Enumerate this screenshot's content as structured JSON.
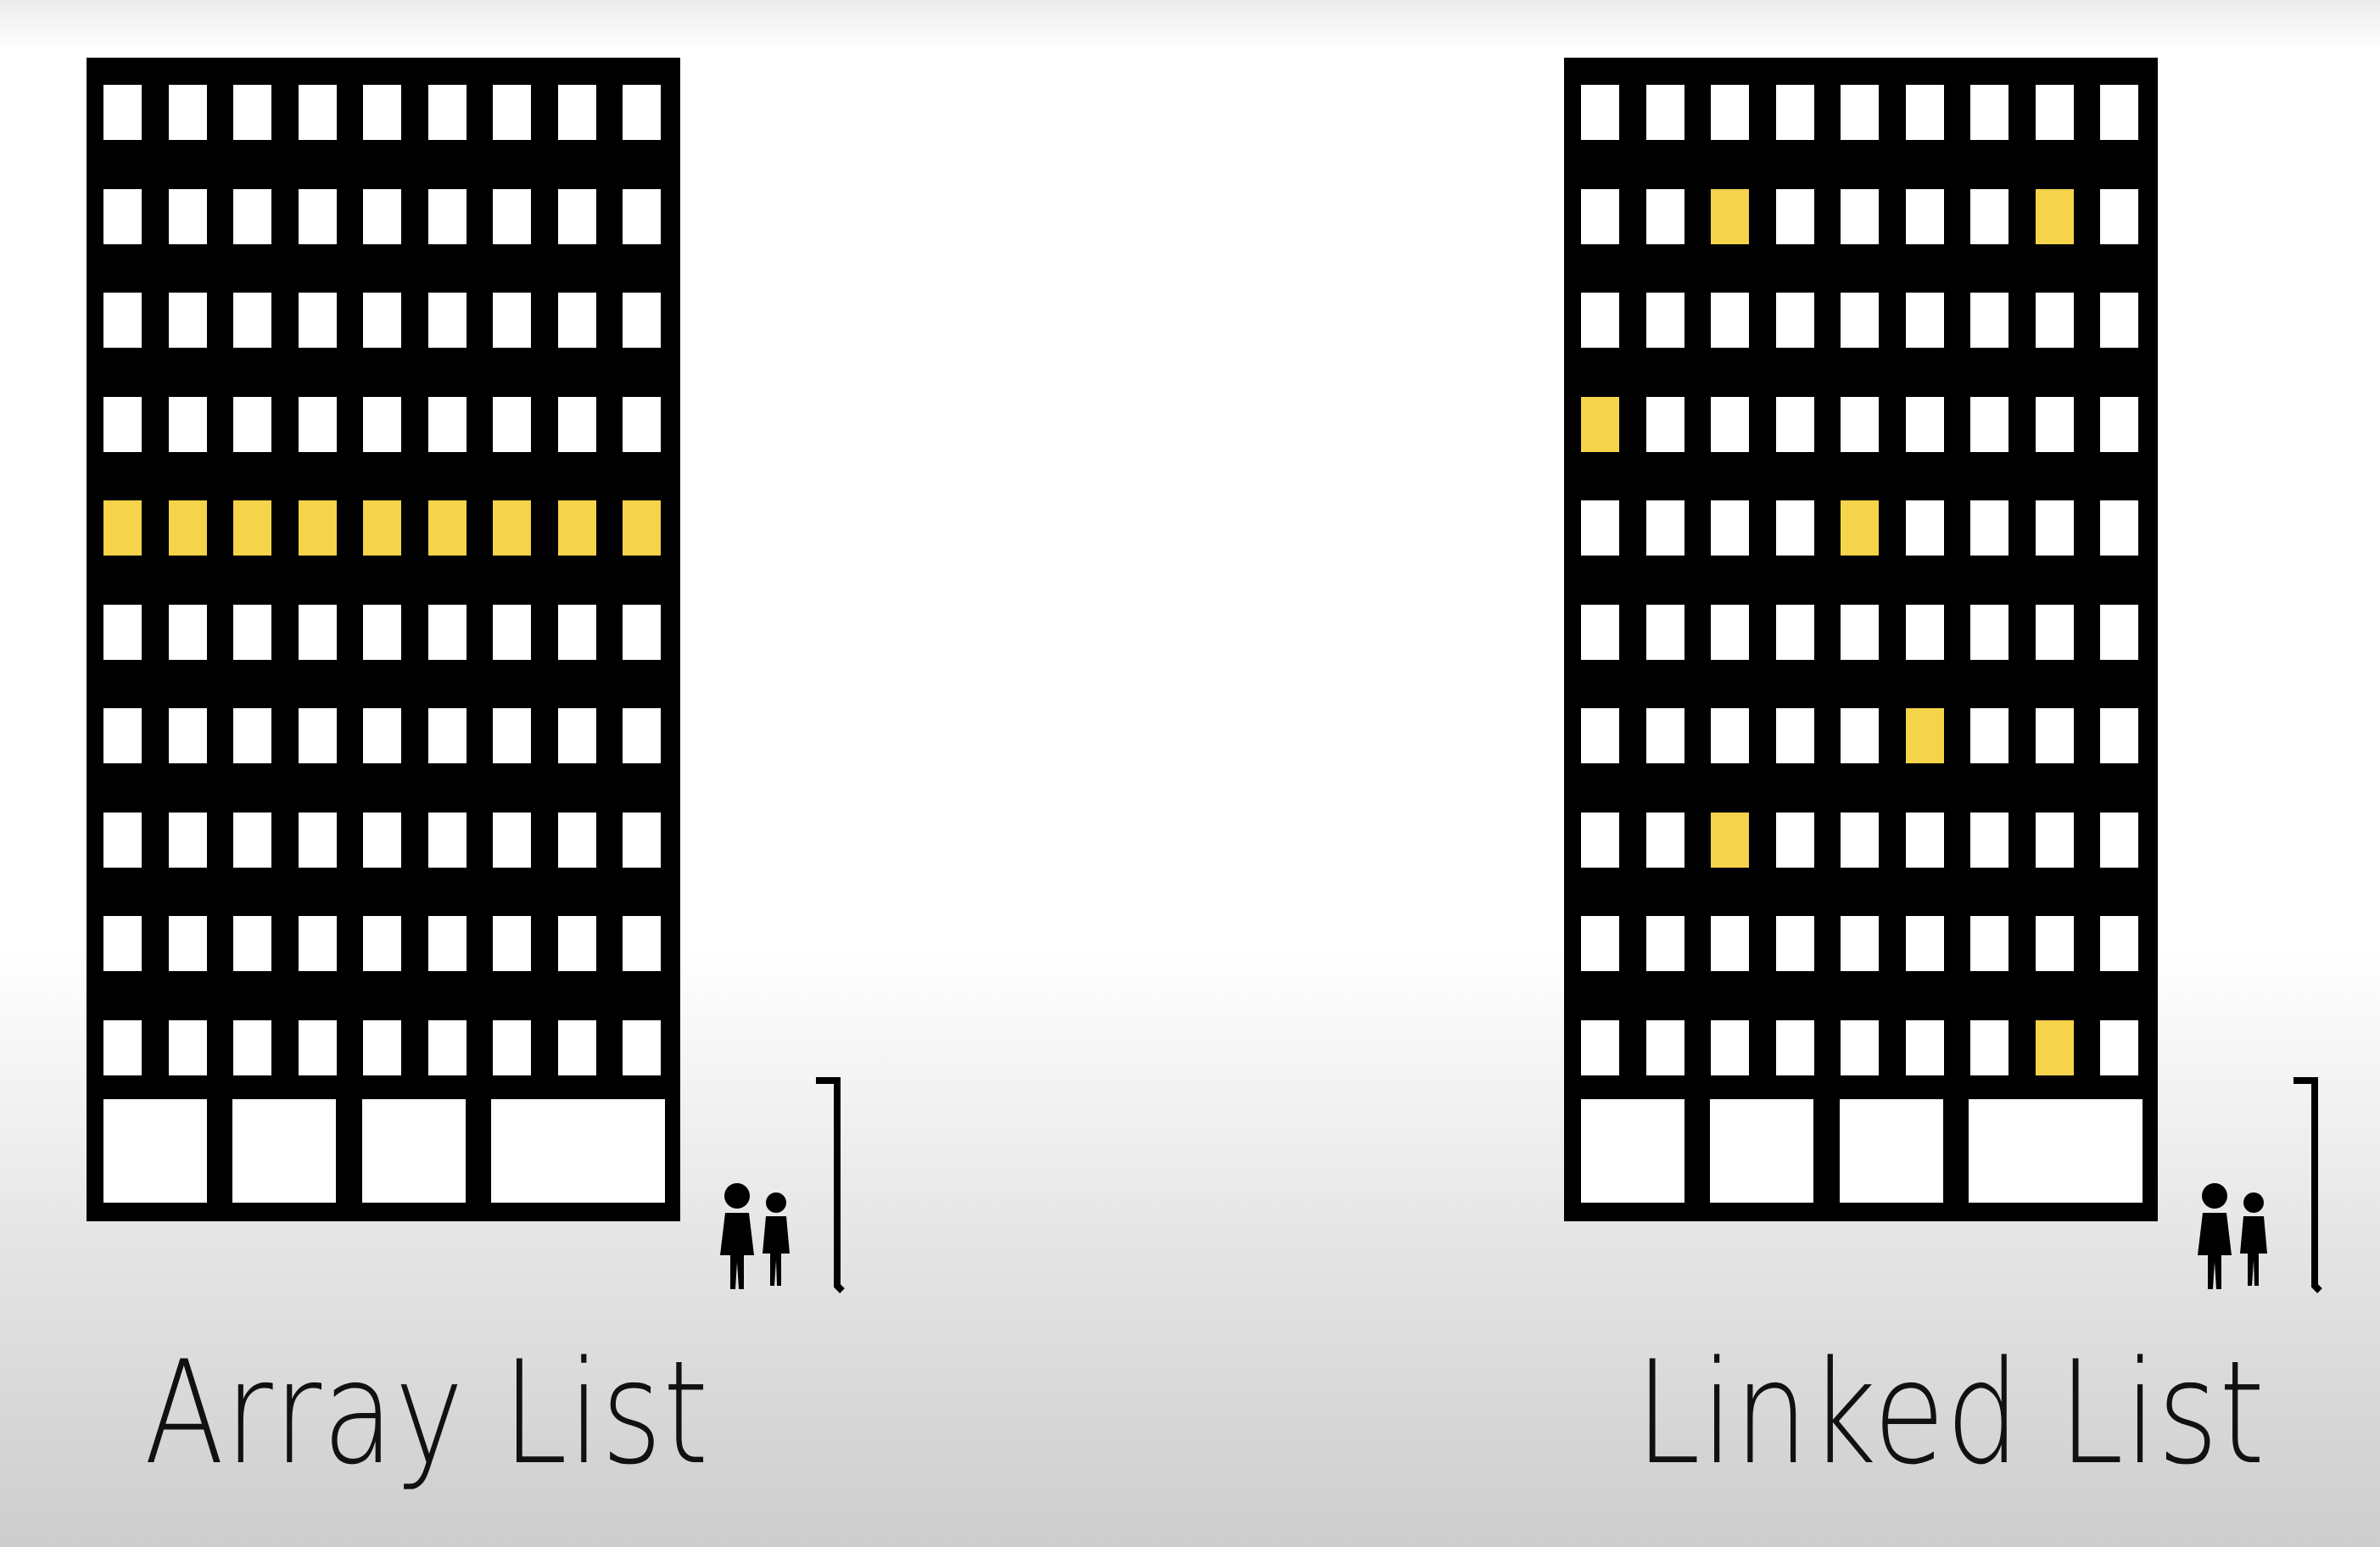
{
  "diagrams": [
    {
      "id": "array-list",
      "label": "Array List",
      "grid": {
        "rows": 10,
        "cols": 9
      },
      "highlighted_cells": [
        [
          4,
          0
        ],
        [
          4,
          1
        ],
        [
          4,
          2
        ],
        [
          4,
          3
        ],
        [
          4,
          4
        ],
        [
          4,
          5
        ],
        [
          4,
          6
        ],
        [
          4,
          7
        ],
        [
          4,
          8
        ]
      ]
    },
    {
      "id": "linked-list",
      "label": "Linked List",
      "grid": {
        "rows": 10,
        "cols": 9
      },
      "highlighted_cells": [
        [
          1,
          2
        ],
        [
          1,
          7
        ],
        [
          3,
          0
        ],
        [
          4,
          4
        ],
        [
          6,
          5
        ],
        [
          7,
          2
        ],
        [
          9,
          7
        ]
      ]
    }
  ],
  "colors": {
    "building": "#000000",
    "window": "#ffffff",
    "highlight": "#f5d34a",
    "label": "#111111"
  },
  "icons": [
    "building-icon",
    "people-icon",
    "lamp-post-icon"
  ]
}
